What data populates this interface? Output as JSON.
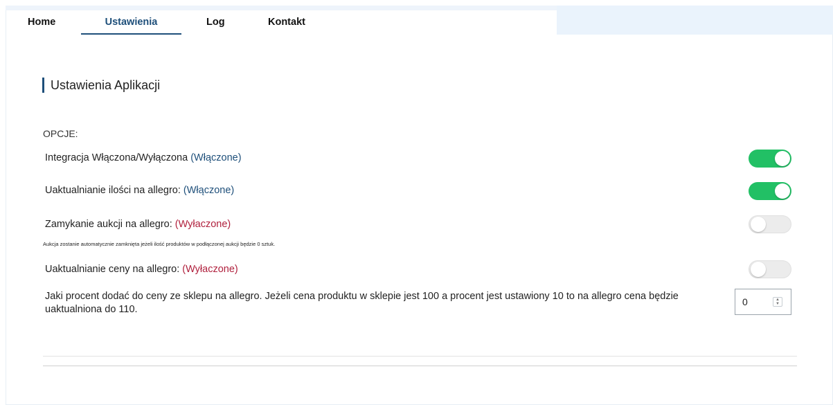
{
  "nav": {
    "tabs": [
      {
        "label": "Home"
      },
      {
        "label": "Ustawienia",
        "active": true
      },
      {
        "label": "Log"
      },
      {
        "label": "Kontakt"
      }
    ]
  },
  "page": {
    "title": "Ustawienia Aplikacji",
    "options_header": "OPCJE:"
  },
  "settings": [
    {
      "label": "Integracja Włączona/Wyłączona",
      "status": "(Włączone)",
      "enabled": true
    },
    {
      "label": "Uaktualnianie ilości na allegro:",
      "status": "(Włączone)",
      "enabled": true
    },
    {
      "label": "Zamykanie aukcji na allegro:",
      "status": "(Wyłaczone)",
      "enabled": false
    },
    {
      "label": "Uaktualnianie ceny na allegro:",
      "status": "(Wyłaczone)",
      "enabled": false
    }
  ],
  "auction_note": "Aukcja zostanie automatycznie zamknięta jeżeli ilość produktów w podłączonej aukcji będzie 0 sztuk.",
  "percent": {
    "description": "Jaki procent dodać do ceny ze sklepu na allegro. Jeżeli cena produktu w sklepie jest 100 a procent jest ustawiony 10 to na allegro cena będzie uaktualniona do 110.",
    "value": "0"
  },
  "colors": {
    "accent": "#1e4f7a",
    "enabled_text": "#1e4f7a",
    "disabled_text": "#b0203d",
    "toggle_on": "#22c065"
  }
}
